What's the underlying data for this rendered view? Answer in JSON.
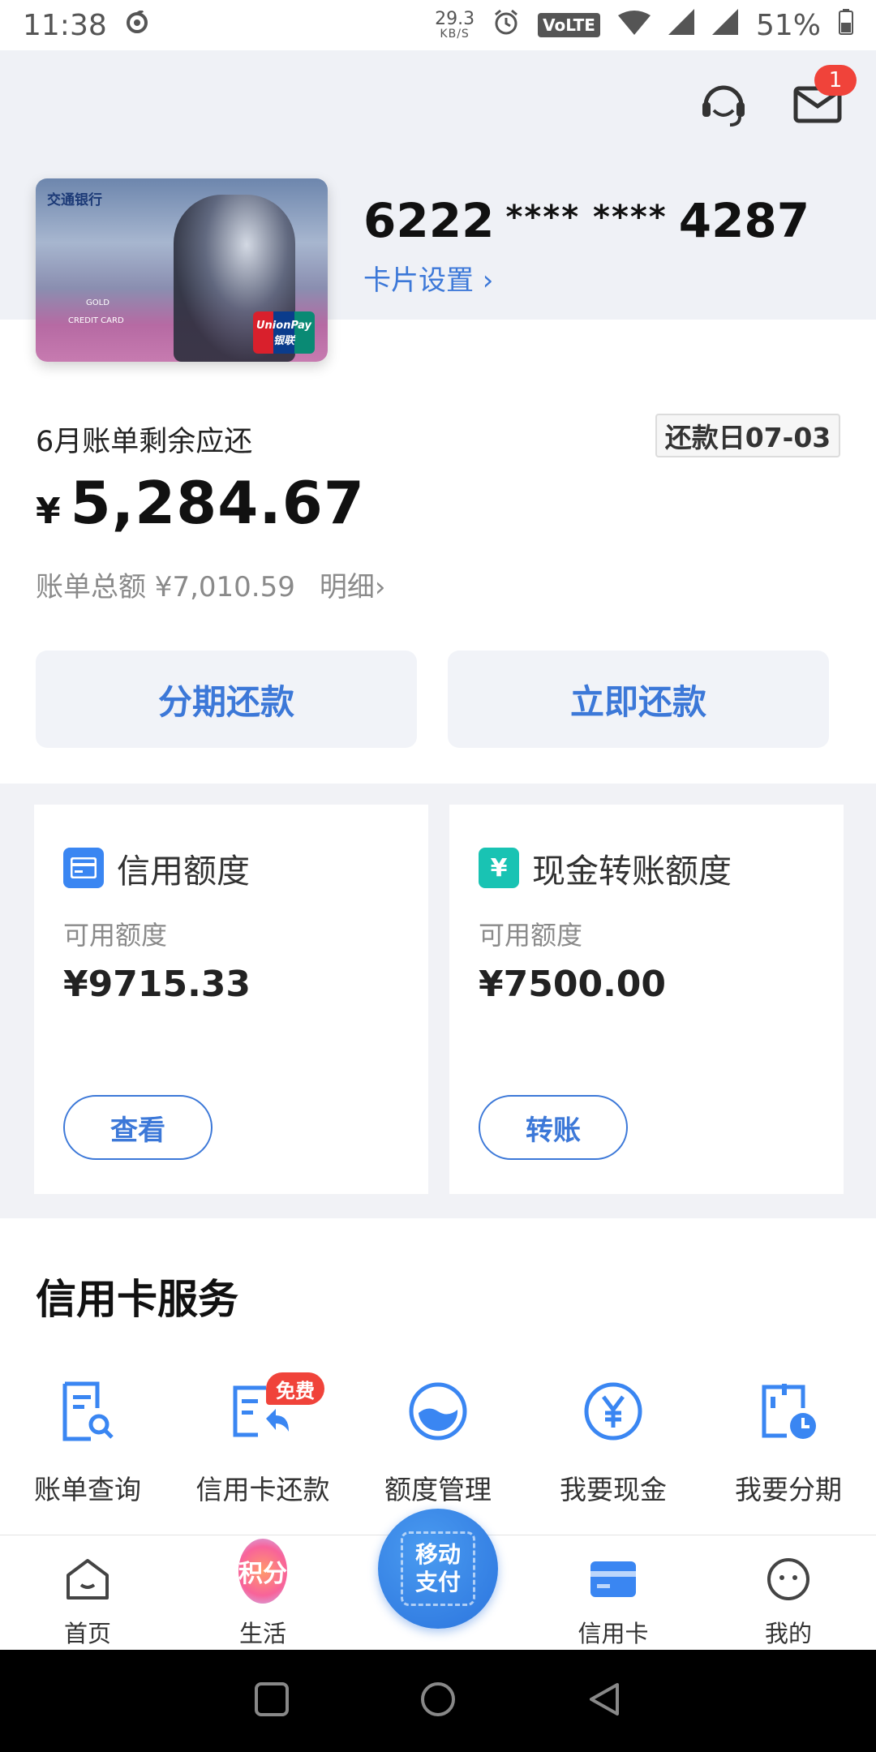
{
  "status_bar": {
    "time": "11:38",
    "net_speed": "29.3",
    "net_unit": "KB/S",
    "volte": "VoLTE",
    "battery": "51%"
  },
  "header": {
    "message_badge": "1"
  },
  "card": {
    "bank_name": "交通银行",
    "gold_label": "GOLD",
    "credit_label": "CREDIT CARD",
    "network_label": "UnionPay 银联",
    "number_prefix": "6222",
    "number_mask": "**** ****",
    "number_suffix": "4287",
    "settings_label": "卡片设置 ›"
  },
  "bill": {
    "title": "6月账单剩余应还",
    "due_date": "还款日07-03",
    "currency": "¥",
    "amount": "5,284.67",
    "total_label": "账单总额 ¥7,010.59",
    "detail_label": "明细›",
    "installment_button": "分期还款",
    "repay_button": "立即还款"
  },
  "limits": [
    {
      "title": "信用额度",
      "sub": "可用额度",
      "value": "¥9715.33",
      "button": "查看",
      "icon": "credit-card-icon",
      "icon_color": "#3a86f2"
    },
    {
      "title": "现金转账额度",
      "sub": "可用额度",
      "value": "¥7500.00",
      "button": "转账",
      "icon": "yen-icon",
      "icon_color": "#19c3b3"
    }
  ],
  "services": {
    "title": "信用卡服务",
    "free_tag": "免费",
    "items": [
      {
        "label": "账单查询",
        "icon": "bill-search-icon"
      },
      {
        "label": "信用卡还款",
        "icon": "repay-icon"
      },
      {
        "label": "额度管理",
        "icon": "limit-manage-icon"
      },
      {
        "label": "我要现金",
        "icon": "cash-icon"
      },
      {
        "label": "我要分期",
        "icon": "installment-icon"
      }
    ]
  },
  "tabbar": {
    "home": "首页",
    "life": "生活",
    "life_badge": "积分",
    "pay_line1": "移动",
    "pay_line2": "支付",
    "credit": "信用卡",
    "mine": "我的"
  },
  "colors": {
    "accent": "#3c78d8",
    "badge": "#f0433a"
  }
}
